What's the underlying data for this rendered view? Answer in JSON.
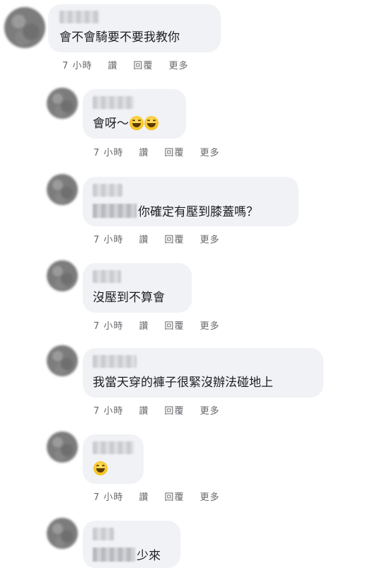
{
  "comments": [
    {
      "text": "會不會騎要不要我教你",
      "actions": {
        "time": "7 小時",
        "like": "讚",
        "reply": "回覆",
        "more": "更多"
      }
    },
    {
      "text": "會呀～",
      "emoji": [
        "grinning-squinting-face",
        "grinning-squinting-face"
      ],
      "actions": {
        "time": "7 小時",
        "like": "讚",
        "reply": "回覆",
        "more": "更多"
      }
    },
    {
      "text": "你確定有壓到膝蓋嗎？",
      "actions": {
        "time": "7 小時",
        "like": "讚",
        "reply": "回覆",
        "more": "更多"
      }
    },
    {
      "text": "沒壓到不算會",
      "actions": {
        "time": "7 小時",
        "like": "讚",
        "reply": "回覆",
        "more": "更多"
      }
    },
    {
      "text": "我當天穿的褲子很緊沒辦法碰地上",
      "actions": {
        "time": "7 小時",
        "like": "讚",
        "reply": "回覆",
        "more": "更多"
      }
    },
    {
      "emoji": [
        "grinning-squinting-face"
      ],
      "actions": {
        "time": "7 小時",
        "like": "讚",
        "reply": "回覆",
        "more": "更多"
      }
    },
    {
      "text": "少來"
    }
  ],
  "colors": {
    "bubble_bg": "#f0f2f5",
    "text": "#1c1e21",
    "meta": "#65676b"
  }
}
